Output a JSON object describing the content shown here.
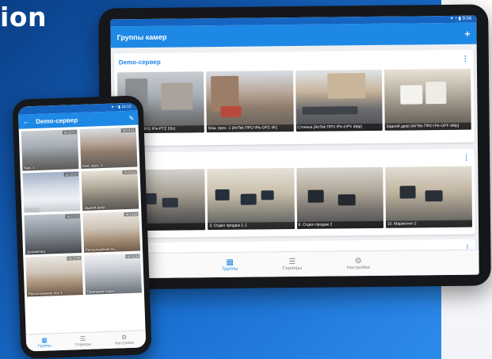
{
  "hero": {
    "title_fragment": "ion"
  },
  "tablet": {
    "status_time": "▾ ◔ ▮ 9:56",
    "app_title": "Группы камер",
    "add_icon": "+",
    "group1": {
      "name": "Demo-сервер",
      "cameras": [
        "Кам. (AirTek ПРО IPe-PTZ 20x)",
        "Ком. прос. 1 [AirTek ПРО IPe-OPZ 4K]",
        "Стоянка [AirTek ПРО IPe-OPV 4Mp]",
        "Задний двор [AirTek ПРО IPe-OPF 4Mp]"
      ]
    },
    "group2": {
      "cameras": [
        "",
        "3. Отдел продаж 1-1",
        "8. Отдел продаж 2",
        "10. Маркетинг 2"
      ]
    },
    "nav": [
      {
        "label": "Группы",
        "icon": "grid-icon"
      },
      {
        "label": "Серверы",
        "icon": "server-icon"
      },
      {
        "label": "Настройки",
        "icon": "gear-icon"
      }
    ]
  },
  "phone": {
    "status_time": "▾ ◔ ▮ 16:15",
    "app_title": "Demo-сервер",
    "cameras": [
      {
        "label": "Кам. 1",
        "time": "16:15:51"
      },
      {
        "label": "Ком. прос. 1",
        "time": "16:15:51"
      },
      {
        "label": "Стоянка",
        "time": "16:15:52"
      },
      {
        "label": "Задний двор",
        "time": "16:15:52"
      },
      {
        "label": "Докуменец",
        "time": "16:15:52"
      },
      {
        "label": "Расположение по...",
        "time": "16:15:53"
      },
      {
        "label": "Расположение пос 1",
        "time": "16:15:53"
      },
      {
        "label": "Приемная отдел",
        "time": "16:15:54"
      }
    ],
    "nav": [
      {
        "label": "Группы",
        "icon": "grid-icon"
      },
      {
        "label": "Серверы",
        "icon": "server-icon"
      },
      {
        "label": "Настройки",
        "icon": "gear-icon"
      }
    ]
  }
}
